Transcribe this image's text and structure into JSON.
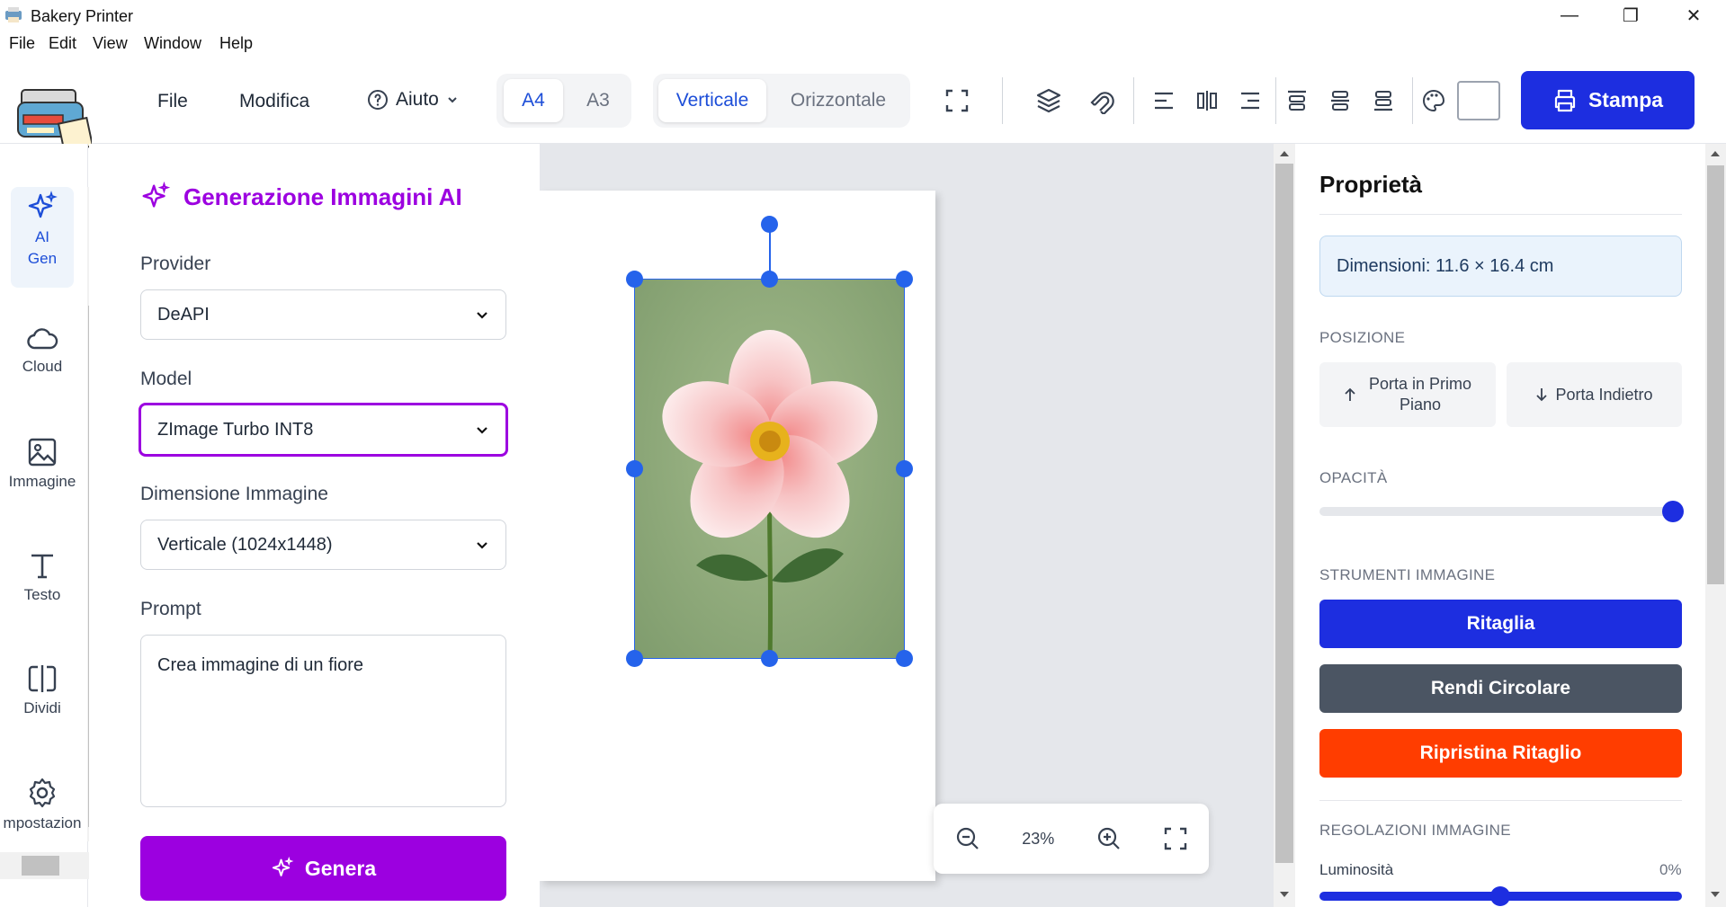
{
  "window": {
    "title": "Bakery Printer",
    "minimize": "—",
    "maximize": "❐",
    "close": "✕"
  },
  "menu": [
    "File",
    "Edit",
    "View",
    "Window",
    "Help"
  ],
  "toolbar": {
    "file": "File",
    "modifica": "Modifica",
    "aiuto": "Aiuto",
    "paper_sizes": [
      "A4",
      "A3"
    ],
    "orientations": [
      "Verticale",
      "Orizzontale"
    ],
    "print_label": "Stampa"
  },
  "nav": {
    "items": [
      {
        "label_line1": "AI",
        "label_line2": "Gen",
        "icon": "sparkles-icon"
      },
      {
        "label": "Cloud",
        "icon": "cloud-icon"
      },
      {
        "label": "Immagine",
        "icon": "image-icon"
      },
      {
        "label": "Testo",
        "icon": "text-icon"
      },
      {
        "label": "Dividi",
        "icon": "split-icon"
      },
      {
        "label": "mpostazion",
        "icon": "gear-icon"
      }
    ]
  },
  "ai_panel": {
    "title": "Generazione Immagini AI",
    "provider_label": "Provider",
    "provider_value": "DeAPI",
    "model_label": "Model",
    "model_value": "ZImage Turbo INT8",
    "size_label": "Dimensione Immagine",
    "size_value": "Verticale (1024x1448)",
    "prompt_label": "Prompt",
    "prompt_value": "Crea immagine di un fiore",
    "generate_label": "Genera"
  },
  "canvas": {
    "zoom": "23%"
  },
  "properties": {
    "title": "Proprietà",
    "dimensions": "Dimensioni: 11.6 × 16.4 cm",
    "position_title": "POSIZIONE",
    "bring_front_line1": "Porta in Primo",
    "bring_front_line2": "Piano",
    "send_back": "Porta Indietro",
    "opacity_title": "OPACITÀ",
    "opacity_value": 1.0,
    "tools_title": "STRUMENTI IMMAGINE",
    "crop": "Ritaglia",
    "circular": "Rendi Circolare",
    "reset_crop": "Ripristina Ritaglio",
    "adjust_title": "REGOLAZIONI IMMAGINE",
    "brightness_label": "Luminosità",
    "brightness_value": "0%"
  },
  "colors": {
    "accent_blue": "#1d2ee0",
    "purple": "#9c00e0",
    "gray_button": "#4b5563",
    "orange": "#ff3d00"
  }
}
